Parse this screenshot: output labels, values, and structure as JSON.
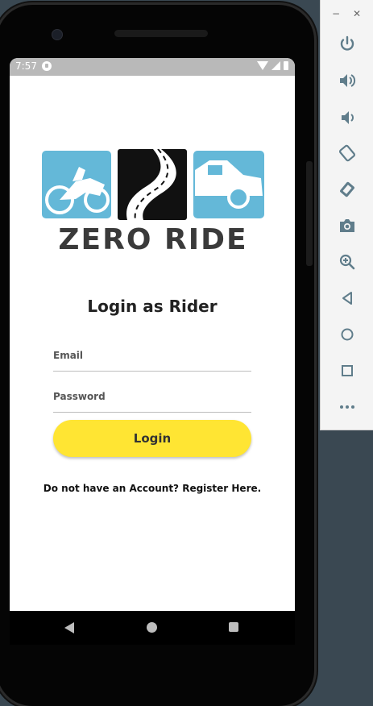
{
  "status_bar": {
    "time": "7:57"
  },
  "logo": {
    "brand_text": "ZERO RIDE"
  },
  "login": {
    "title": "Login as Rider",
    "email_placeholder": "Email",
    "password_placeholder": "Password",
    "button_label": "Login",
    "register_text": "Do not have an Account? Register Here."
  },
  "emulator_toolbar": {
    "minimize_glyph": "−",
    "close_glyph": "✕",
    "buttons": [
      "power-icon",
      "volume-up-icon",
      "volume-down-icon",
      "rotate-left-icon",
      "rotate-right-icon",
      "camera-icon",
      "zoom-icon",
      "back-icon",
      "home-icon",
      "overview-icon",
      "more-icon"
    ]
  },
  "colors": {
    "accent_yellow": "#ffe533",
    "logo_blue": "#64b8d8",
    "toolbar_icon": "#607d8b"
  }
}
